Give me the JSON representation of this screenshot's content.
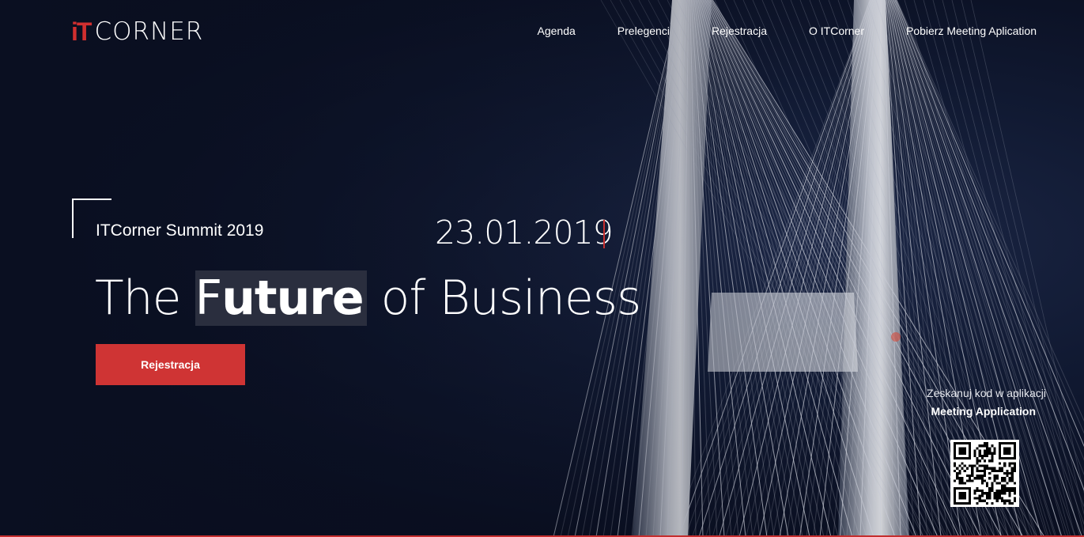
{
  "brand": {
    "logo_mark": "iT",
    "logo_word": "CORNER"
  },
  "nav": {
    "items": [
      {
        "label": "Agenda"
      },
      {
        "label": "Prelegenci"
      },
      {
        "label": "Rejestracja"
      },
      {
        "label": "O ITCorner"
      },
      {
        "label": "Pobierz Meeting Aplication"
      }
    ]
  },
  "hero": {
    "summit_name": "ITCorner Summit 2019",
    "date": "23.01.2019",
    "headline_before": "The ",
    "headline_highlight_plain": "F",
    "headline_highlight_bold": "uture",
    "headline_after": " of Business",
    "cta_label": "Rejestracja"
  },
  "app_promo": {
    "scan_text": "Zeskanuj kod w aplikacji",
    "app_name": "Meeting Application",
    "qr_icon": "qr-code-icon"
  },
  "colors": {
    "accent": "#cf3434",
    "background": "#0b1022",
    "text": "#ffffff"
  }
}
